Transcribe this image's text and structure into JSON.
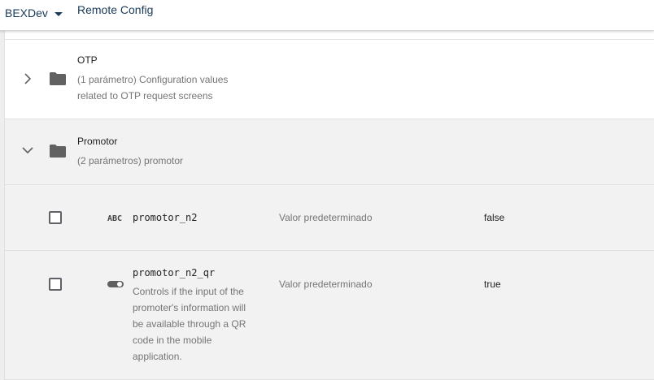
{
  "header": {
    "project_name": "BEXDev",
    "page_title": "Remote Config"
  },
  "groups": [
    {
      "name": "OTP",
      "description_line1": "(1 parámetro) Configuration values",
      "description_line2": "related to OTP request screens",
      "expanded": false
    },
    {
      "name": "Promotor",
      "description": "(2 parámetros) promotor",
      "expanded": true
    }
  ],
  "parameters": [
    {
      "key": "promotor_n2",
      "type_icon": "abc-string-icon",
      "type_label": "ABC",
      "condition": "Valor predeterminado",
      "value": "false"
    },
    {
      "key": "promotor_n2_qr",
      "type_icon": "toggle-boolean-icon",
      "description_lines": [
        "Controls if the input of the",
        "promoter's information will",
        "be available through a QR",
        "code in the mobile",
        "application."
      ],
      "condition": "Valor predeterminado",
      "value": "true"
    }
  ],
  "colors": {
    "header_text": "#1a3a57",
    "folder": "#616161",
    "secondary_text": "#757575"
  }
}
